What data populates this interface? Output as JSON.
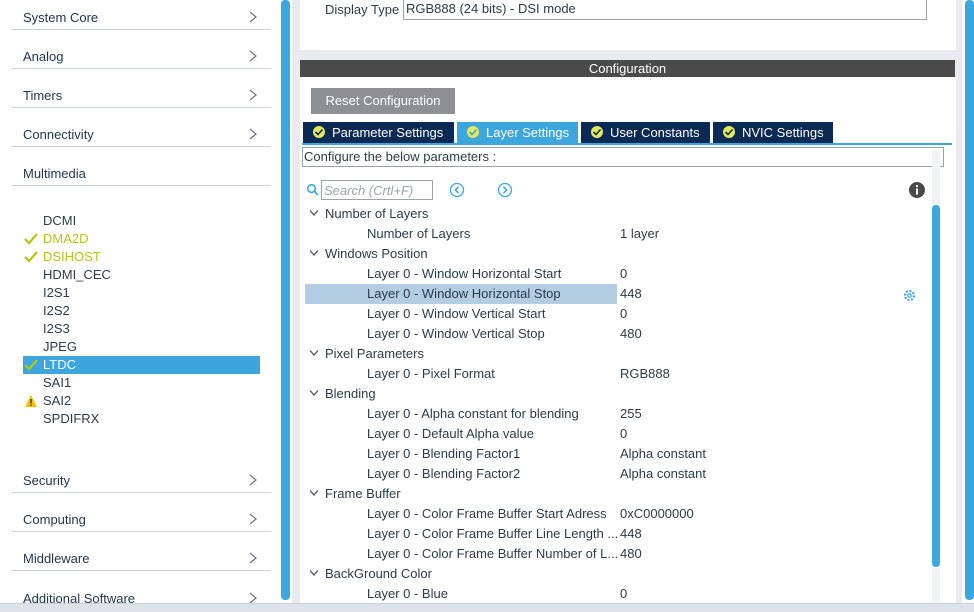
{
  "sidebar": {
    "categories": [
      {
        "label": "System Core"
      },
      {
        "label": "Analog"
      },
      {
        "label": "Timers"
      },
      {
        "label": "Connectivity"
      },
      {
        "label": "Multimedia"
      },
      {
        "label": "Security"
      },
      {
        "label": "Computing"
      },
      {
        "label": "Middleware"
      },
      {
        "label": "Additional Software"
      }
    ],
    "multimedia_items": [
      {
        "label": "DCMI",
        "state": "none"
      },
      {
        "label": "DMA2D",
        "state": "ok"
      },
      {
        "label": "DSIHOST",
        "state": "ok"
      },
      {
        "label": "HDMI_CEC",
        "state": "none"
      },
      {
        "label": "I2S1",
        "state": "none"
      },
      {
        "label": "I2S2",
        "state": "none"
      },
      {
        "label": "I2S3",
        "state": "none"
      },
      {
        "label": "JPEG",
        "state": "none"
      },
      {
        "label": "LTDC",
        "state": "selected"
      },
      {
        "label": "SAI1",
        "state": "none"
      },
      {
        "label": "SAI2",
        "state": "warning"
      },
      {
        "label": "SPDIFRX",
        "state": "none"
      }
    ]
  },
  "display": {
    "label": "Display Type",
    "value": "RGB888 (24 bits) - DSI mode"
  },
  "configuration": {
    "header": "Configuration",
    "reset_label": "Reset Configuration",
    "tabs": [
      {
        "label": "Parameter Settings"
      },
      {
        "label": "Layer Settings"
      },
      {
        "label": "User Constants"
      },
      {
        "label": "NVIC Settings"
      }
    ],
    "active_tab": "Layer Settings",
    "instructions": "Configure the below parameters :",
    "search_placeholder": "Search (Crtl+F)"
  },
  "tree": [
    {
      "group": "Number of Layers"
    },
    {
      "name": "Number of Layers",
      "value": "1 layer"
    },
    {
      "group": "Windows Position"
    },
    {
      "name": "Layer 0 - Window Horizontal Start",
      "value": "0"
    },
    {
      "name": "Layer 0 - Window Horizontal Stop",
      "value": "448",
      "selected": true
    },
    {
      "name": "Layer 0 - Window Vertical Start",
      "value": "0"
    },
    {
      "name": "Layer 0 - Window Vertical Stop",
      "value": "480"
    },
    {
      "group": "Pixel Parameters"
    },
    {
      "name": "Layer 0 - Pixel Format",
      "value": "RGB888"
    },
    {
      "group": "Blending"
    },
    {
      "name": "Layer 0 - Alpha constant for blending",
      "value": "255"
    },
    {
      "name": "Layer 0 - Default Alpha value",
      "value": "0"
    },
    {
      "name": "Layer 0 - Blending Factor1",
      "value": "Alpha constant"
    },
    {
      "name": "Layer 0 - Blending Factor2",
      "value": "Alpha constant"
    },
    {
      "group": "Frame Buffer"
    },
    {
      "name": "Layer 0 - Color Frame Buffer Start Adress",
      "value": "0xC0000000"
    },
    {
      "name": "Layer 0 - Color Frame Buffer Line Length ...",
      "value": "448"
    },
    {
      "name": "Layer 0 - Color Frame Buffer Number of L...",
      "value": "480"
    },
    {
      "group": "BackGround Color"
    },
    {
      "name": "Layer 0 - Blue",
      "value": "0"
    }
  ],
  "colors": {
    "accent": "#3da6dc",
    "tab_dark": "#0b2a53",
    "ok": "#b5c314",
    "warning": "#f2c200"
  }
}
